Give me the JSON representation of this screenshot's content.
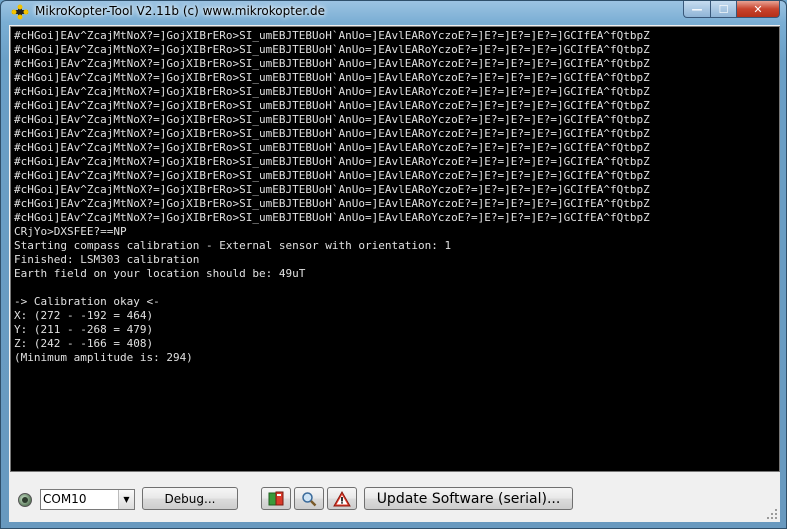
{
  "window": {
    "title": "MikroKopter-Tool V2.11b (c) www.mikrokopter.de",
    "caption_buttons": {
      "minimize": "—",
      "maximize": "☐",
      "close": "✕"
    }
  },
  "console": {
    "lines": [
      "#cHGoi]EAv^ZcajMtNoX?=]GojXIBrERo>SI_umEBJTEBUoH`AnUo=]EAvlEARoYczoE?=]E?=]E?=]E?=]GCIfEA^fQtbpZ",
      "#cHGoi]EAv^ZcajMtNoX?=]GojXIBrERo>SI_umEBJTEBUoH`AnUo=]EAvlEARoYczoE?=]E?=]E?=]E?=]GCIfEA^fQtbpZ",
      "#cHGoi]EAv^ZcajMtNoX?=]GojXIBrERo>SI_umEBJTEBUoH`AnUo=]EAvlEARoYczoE?=]E?=]E?=]E?=]GCIfEA^fQtbpZ",
      "#cHGoi]EAv^ZcajMtNoX?=]GojXIBrERo>SI_umEBJTEBUoH`AnUo=]EAvlEARoYczoE?=]E?=]E?=]E?=]GCIfEA^fQtbpZ",
      "#cHGoi]EAv^ZcajMtNoX?=]GojXIBrERo>SI_umEBJTEBUoH`AnUo=]EAvlEARoYczoE?=]E?=]E?=]E?=]GCIfEA^fQtbpZ",
      "#cHGoi]EAv^ZcajMtNoX?=]GojXIBrERo>SI_umEBJTEBUoH`AnUo=]EAvlEARoYczoE?=]E?=]E?=]E?=]GCIfEA^fQtbpZ",
      "#cHGoi]EAv^ZcajMtNoX?=]GojXIBrERo>SI_umEBJTEBUoH`AnUo=]EAvlEARoYczoE?=]E?=]E?=]E?=]GCIfEA^fQtbpZ",
      "#cHGoi]EAv^ZcajMtNoX?=]GojXIBrERo>SI_umEBJTEBUoH`AnUo=]EAvlEARoYczoE?=]E?=]E?=]E?=]GCIfEA^fQtbpZ",
      "#cHGoi]EAv^ZcajMtNoX?=]GojXIBrERo>SI_umEBJTEBUoH`AnUo=]EAvlEARoYczoE?=]E?=]E?=]E?=]GCIfEA^fQtbpZ",
      "#cHGoi]EAv^ZcajMtNoX?=]GojXIBrERo>SI_umEBJTEBUoH`AnUo=]EAvlEARoYczoE?=]E?=]E?=]E?=]GCIfEA^fQtbpZ",
      "#cHGoi]EAv^ZcajMtNoX?=]GojXIBrERo>SI_umEBJTEBUoH`AnUo=]EAvlEARoYczoE?=]E?=]E?=]E?=]GCIfEA^fQtbpZ",
      "#cHGoi]EAv^ZcajMtNoX?=]GojXIBrERo>SI_umEBJTEBUoH`AnUo=]EAvlEARoYczoE?=]E?=]E?=]E?=]GCIfEA^fQtbpZ",
      "#cHGoi]EAv^ZcajMtNoX?=]GojXIBrERo>SI_umEBJTEBUoH`AnUo=]EAvlEARoYczoE?=]E?=]E?=]E?=]GCIfEA^fQtbpZ",
      "#cHGoi]EAv^ZcajMtNoX?=]GojXIBrERo>SI_umEBJTEBUoH`AnUo=]EAvlEARoYczoE?=]E?=]E?=]E?=]GCIfEA^fQtbpZ",
      "CRjYo>DXSFEE?==NP",
      "Starting compass calibration - External sensor with orientation: 1",
      "Finished: LSM303 calibration",
      "Earth field on your location should be: 49uT",
      "",
      "-> Calibration okay <-",
      "X: (272 - -192 = 464)",
      "Y: (211 - -268 = 479)",
      "Z: (242 - -166 = 408)",
      "(Minimum amplitude is: 294)"
    ]
  },
  "toolbar": {
    "com_port": "COM10",
    "debug_label": "Debug...",
    "update_label": "Update Software (serial)...",
    "icons": [
      "book-icon",
      "magnifier-icon",
      "warning-icon"
    ]
  },
  "colors": {
    "console_bg": "#000000",
    "console_fg": "#e0e0e0",
    "close_button": "#c7432d"
  }
}
